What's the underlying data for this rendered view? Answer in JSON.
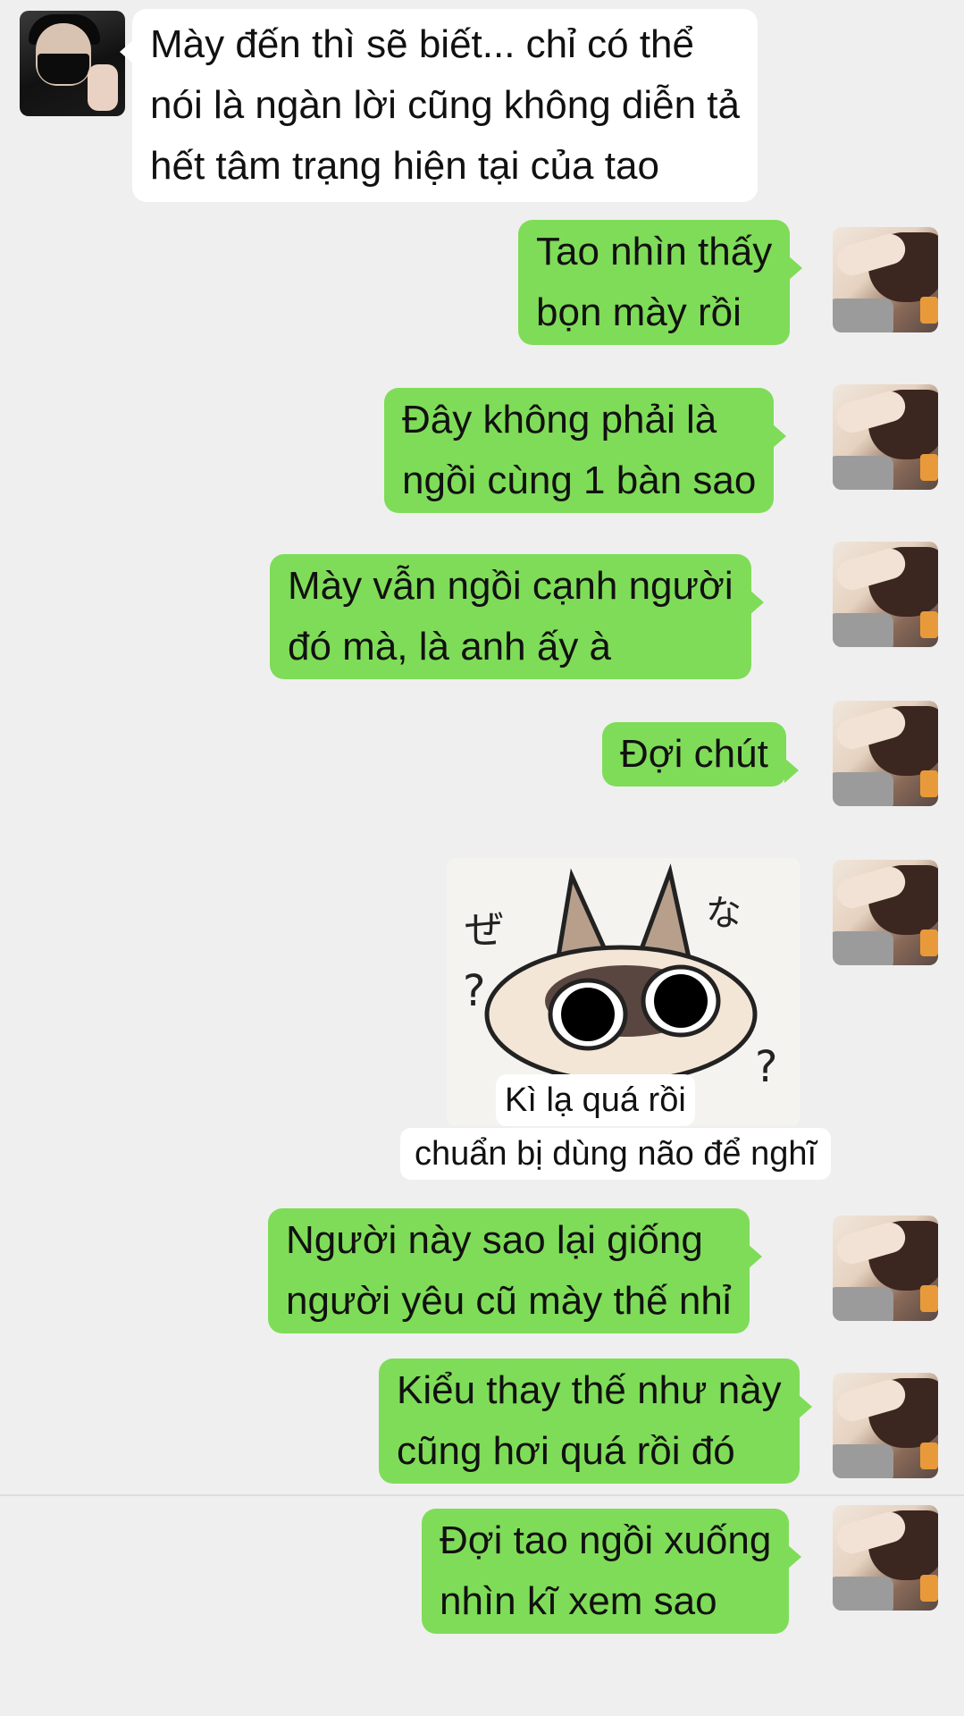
{
  "messages": [
    {
      "side": "left",
      "lines": [
        "Mày đến thì sẽ biết... chỉ có thể",
        "nói là ngàn lời cũng không diễn tả",
        "hết tâm trạng hiện tại của tao"
      ]
    },
    {
      "side": "right",
      "lines": [
        "Tao nhìn thấy",
        "bọn mày rồi"
      ]
    },
    {
      "side": "right",
      "lines": [
        "Đây không phải là",
        "ngồi cùng 1 bàn sao"
      ]
    },
    {
      "side": "right",
      "lines": [
        "Mày vẫn ngồi cạnh người",
        "đó mà, là anh ấy à"
      ]
    },
    {
      "side": "right",
      "lines": [
        "Đợi chút"
      ]
    },
    {
      "side": "right",
      "type": "sticker",
      "caption_lines": [
        "Kì lạ quá rồi",
        "chuẩn bị dùng não để nghĩ"
      ]
    },
    {
      "side": "right",
      "lines": [
        "Người này sao lại giống",
        "người yêu cũ mày thế nhỉ"
      ]
    },
    {
      "side": "right",
      "lines": [
        "Kiểu thay thế như này",
        "cũng hơi quá rồi đó"
      ]
    },
    {
      "side": "right",
      "lines": [
        "Đợi tao ngồi xuống",
        "nhìn kĩ xem sao"
      ]
    }
  ],
  "colors": {
    "sent_bubble": "#7fdc58",
    "received_bubble": "#ffffff",
    "background": "#efefef"
  }
}
